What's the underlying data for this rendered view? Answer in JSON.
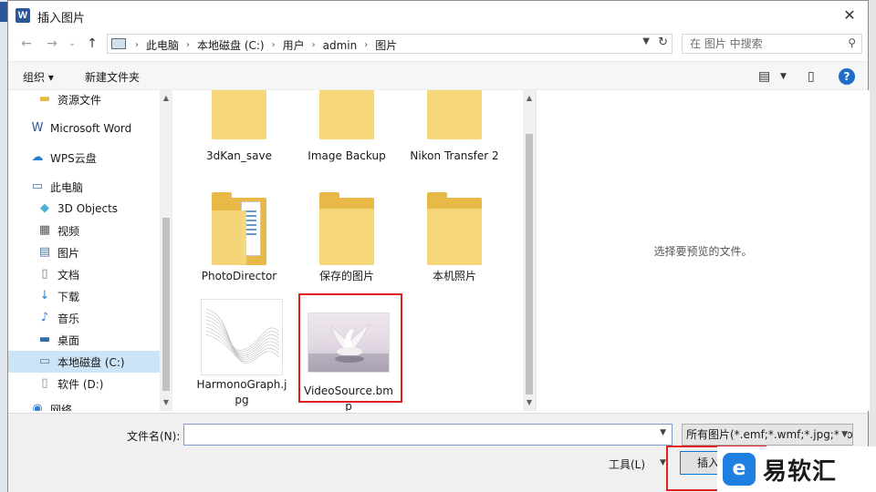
{
  "window": {
    "app_icon_letter": "W",
    "title": "插入图片",
    "close_glyph": "✕"
  },
  "nav": {
    "back_glyph": "←",
    "forward_glyph": "→",
    "recent_glyph": "⌄",
    "up_glyph": "↑",
    "breadcrumbs": [
      "此电脑",
      "本地磁盘 (C:)",
      "用户",
      "admin",
      "图片"
    ],
    "separator": "›",
    "search_placeholder": "在 图片 中搜索"
  },
  "toolbar": {
    "organize_label": "组织 ▾",
    "new_folder_label": "新建文件夹"
  },
  "sidebar": {
    "items": [
      {
        "label": "资源文件",
        "icon": "folder-icon",
        "glyph": "▬",
        "color": "#e8b947"
      },
      {
        "label": "Microsoft Word",
        "icon": "word-icon",
        "glyph": "W",
        "color": "#2b579a"
      },
      {
        "label": "WPS云盘",
        "icon": "cloud-icon",
        "glyph": "☁",
        "color": "#2f7fd1"
      },
      {
        "label": "此电脑",
        "icon": "computer-icon",
        "glyph": "▭",
        "color": "#3a78b8"
      },
      {
        "label": "3D Objects",
        "icon": "cube-icon",
        "glyph": "◆",
        "color": "#4ab0d6"
      },
      {
        "label": "视频",
        "icon": "video-icon",
        "glyph": "▦",
        "color": "#555555"
      },
      {
        "label": "图片",
        "icon": "pictures-icon",
        "glyph": "▤",
        "color": "#4a7aa8"
      },
      {
        "label": "文档",
        "icon": "document-icon",
        "glyph": "▯",
        "color": "#6b7d8f"
      },
      {
        "label": "下载",
        "icon": "download-icon",
        "glyph": "↓",
        "color": "#2f7fd1"
      },
      {
        "label": "音乐",
        "icon": "music-icon",
        "glyph": "♪",
        "color": "#2f7fd1"
      },
      {
        "label": "桌面",
        "icon": "desktop-icon",
        "glyph": "▬",
        "color": "#2f6db0"
      },
      {
        "label": "本地磁盘 (C:)",
        "icon": "drive-icon",
        "glyph": "▭",
        "color": "#6b7d8f"
      },
      {
        "label": "软件 (D:)",
        "icon": "drive-icon",
        "glyph": "▯",
        "color": "#8a8a8a"
      },
      {
        "label": "网络",
        "icon": "network-icon",
        "glyph": "◉",
        "color": "#2f7fd1"
      }
    ],
    "selected_index": 11
  },
  "files": [
    {
      "label": "3dKan_save",
      "type": "folder"
    },
    {
      "label": "Image Backup",
      "type": "folder"
    },
    {
      "label": "Nikon Transfer 2",
      "type": "folder"
    },
    {
      "label": "PhotoDirector",
      "type": "folder-doc"
    },
    {
      "label": "保存的图片",
      "type": "folder"
    },
    {
      "label": "本机照片",
      "type": "folder"
    },
    {
      "label": "HarmonoGraph.jpg",
      "type": "image-wave"
    },
    {
      "label": "VideoSource.bmp",
      "type": "image-swan"
    }
  ],
  "preview": {
    "empty_text": "选择要预览的文件。"
  },
  "bottom": {
    "filename_label": "文件名(N):",
    "filename_value": "",
    "filetype_value": "所有图片(*.emf;*.wmf;*.jpg;*.jpeg;*.jpe;*.png;*.bmp;*.gif)",
    "tools_label": "工具(L)",
    "insert_label": "插入(S)"
  },
  "watermark": {
    "logo_glyph": "e",
    "text": "易软汇"
  }
}
